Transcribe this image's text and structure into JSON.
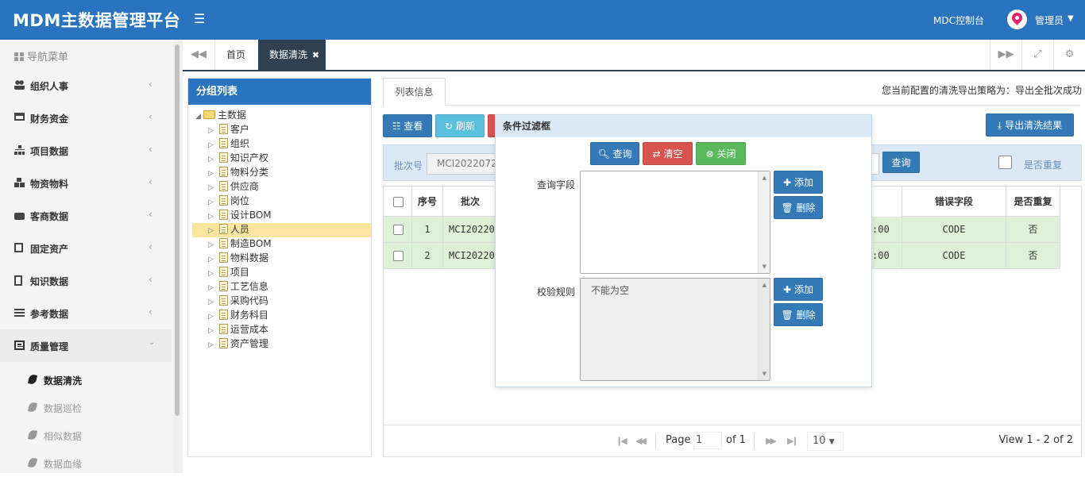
{
  "app": {
    "title": "MDM主数据管理平台",
    "console": "MDC控制台",
    "user": "管理员"
  },
  "colors": {
    "brand": "#2a73be",
    "tab_active": "#2f4050",
    "row_highlight": "#dff0d8"
  },
  "sidebar": {
    "header": "导航菜单",
    "items": [
      {
        "label": "组织人事",
        "icon": "users-icon"
      },
      {
        "label": "财务资金",
        "icon": "credit-card-icon"
      },
      {
        "label": "项目数据",
        "icon": "sitemap-icon"
      },
      {
        "label": "物资物料",
        "icon": "cubes-icon"
      },
      {
        "label": "客商数据",
        "icon": "briefcase-icon"
      },
      {
        "label": "固定资产",
        "icon": "calculator-icon"
      },
      {
        "label": "知识数据",
        "icon": "book-icon"
      },
      {
        "label": "参考数据",
        "icon": "list-icon"
      },
      {
        "label": "质量管理",
        "icon": "newspaper-icon"
      }
    ],
    "subitems": [
      {
        "label": "数据清洗",
        "icon": "leaf-icon"
      },
      {
        "label": "数据巡检",
        "icon": "leaf-icon"
      },
      {
        "label": "相似数据",
        "icon": "leaf-icon"
      },
      {
        "label": "数据血缘",
        "icon": "leaf-icon"
      }
    ]
  },
  "tabs": {
    "home": "首页",
    "active": "数据清洗"
  },
  "tree": {
    "title": "分组列表",
    "root": "主数据",
    "nodes": [
      "客户",
      "组织",
      "知识产权",
      "物料分类",
      "供应商",
      "岗位",
      "设计BOM",
      "人员",
      "制造BOM",
      "物料数据",
      "项目",
      "工艺信息",
      "采购代码",
      "财务科目",
      "运营成本",
      "资产管理"
    ],
    "selected_index": 7
  },
  "main": {
    "tab": "列表信息",
    "policy": "您当前配置的清洗导出策略为：导出全批次成功",
    "toolbar": {
      "view": "查看",
      "refresh": "刷新",
      "export": "导出清洗结果"
    },
    "search": {
      "batch_label": "批次号",
      "batch_value": "MCI2022072",
      "query": "查询",
      "dup_label": "是否重复"
    }
  },
  "table": {
    "headers": {
      "seq": "序号",
      "batch": "批次",
      "error": "错误字段",
      "dup": "是否重复"
    },
    "rows": [
      {
        "seq": "1",
        "batch": "MCI20220",
        "time": ":00",
        "error": "CODE",
        "dup": "否"
      },
      {
        "seq": "2",
        "batch": "MCI20220",
        "time": ":00",
        "error": "CODE",
        "dup": "否"
      }
    ]
  },
  "pager": {
    "page_label": "Page",
    "page": "1",
    "of": "of 1",
    "size": "10",
    "view": "View 1 - 2 of 2"
  },
  "dialog": {
    "title": "条件过滤框",
    "query": "查询",
    "clear": "清空",
    "close": "关闭",
    "field_label": "查询字段",
    "rule_label": "校验规则",
    "rule_value": "不能为空",
    "add": "添加",
    "delete": "删除"
  }
}
